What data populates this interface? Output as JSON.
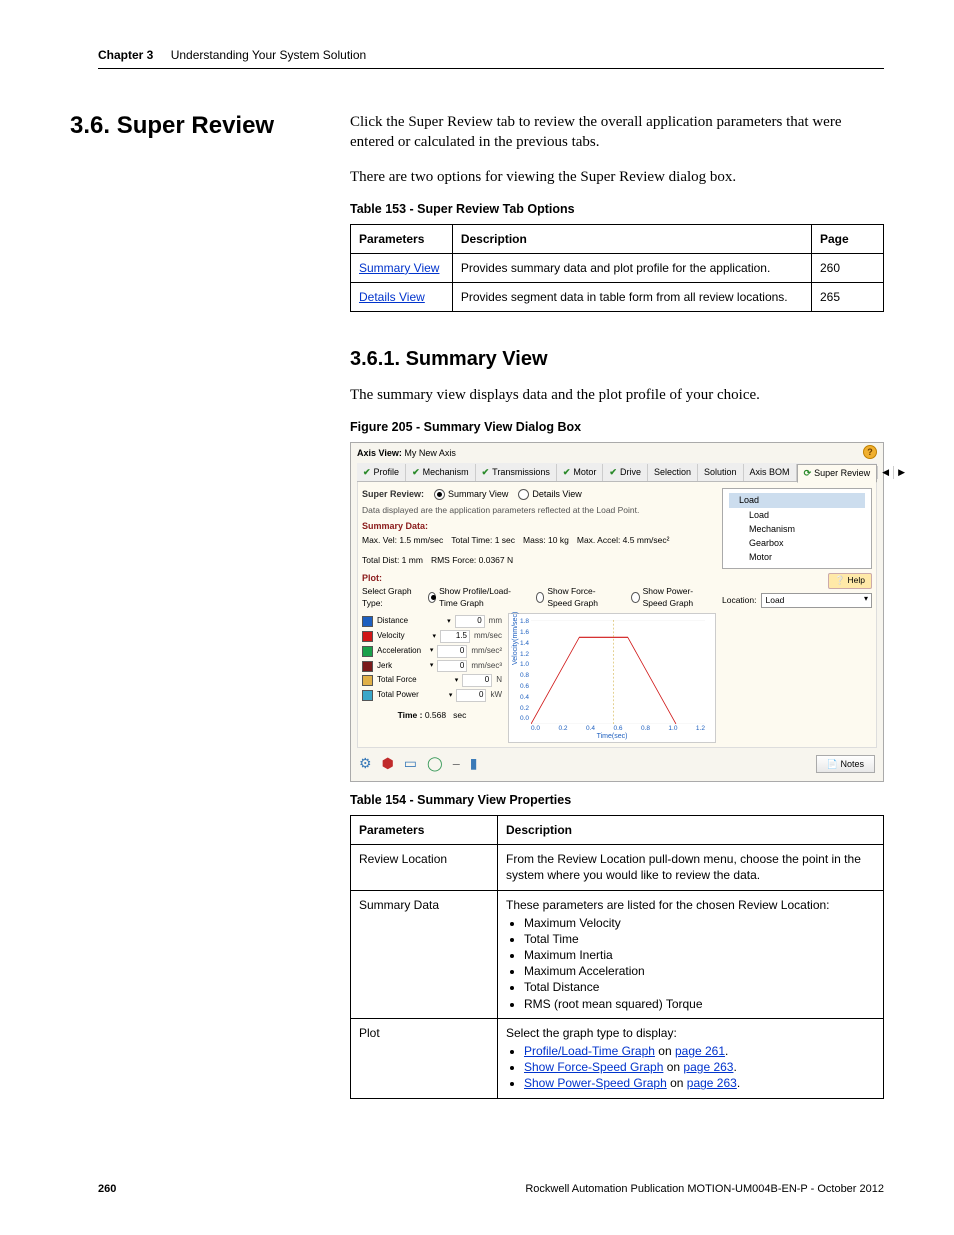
{
  "header": {
    "chapter": "Chapter 3",
    "title": "Understanding Your System Solution"
  },
  "section": {
    "number_title": "3.6.  Super Review",
    "intro1": "Click the Super Review tab to review the overall application parameters that were entered or calculated in the previous tabs.",
    "intro2": "There are two options for viewing the Super Review dialog box."
  },
  "table153": {
    "caption": "Table 153 - Super Review Tab Options",
    "headers": [
      "Parameters",
      "Description",
      "Page"
    ],
    "rows": [
      {
        "param": "Summary View",
        "desc": "Provides summary data and plot profile for the application.",
        "page": "260"
      },
      {
        "param": "Details View",
        "desc": "Provides segment data in table form from all review locations.",
        "page": "265"
      }
    ]
  },
  "subsection": {
    "title": "3.6.1.   Summary View",
    "intro": "The summary view displays data and the plot profile of your choice."
  },
  "figure": {
    "caption": "Figure 205 - Summary View Dialog Box"
  },
  "screenshot": {
    "axis_view_label": "Axis View:",
    "axis_view_value": "My New Axis",
    "tabs": [
      "Profile",
      "Mechanism",
      "Transmissions",
      "Motor",
      "Drive",
      "Selection",
      "Solution",
      "Axis BOM",
      "Super Review"
    ],
    "checked_tabs": [
      0,
      1,
      2,
      3,
      4
    ],
    "reload_tab_index": 8,
    "sr_label": "Super Review:",
    "sr_radio_summary": "Summary View",
    "sr_radio_details": "Details View",
    "hint": "Data displayed are the application parameters reflected at the Load Point.",
    "summary_data_label": "Summary Data:",
    "summary_values": [
      [
        "Max. Vel:",
        "1.5",
        "mm/sec"
      ],
      [
        "Total Time:",
        "1",
        "sec"
      ],
      [
        "Mass:",
        "10",
        "kg"
      ],
      [
        "Max. Accel:",
        "4.5",
        "mm/sec²"
      ],
      [
        "Total Dist:",
        "1",
        "mm"
      ],
      [
        "RMS Force:",
        "0.0367",
        "N"
      ]
    ],
    "plot_label": "Plot:",
    "graph_type_label": "Select Graph Type:",
    "graph_options": [
      "Show Profile/Load-Time Graph",
      "Show Force-Speed Graph",
      "Show Power-Speed Graph"
    ],
    "legend": [
      {
        "name": "Distance",
        "color": "#1d5fbf",
        "val": "0",
        "unit": "mm"
      },
      {
        "name": "Velocity",
        "color": "#d01616",
        "val": "1.5",
        "unit": "mm/sec"
      },
      {
        "name": "Acceleration",
        "color": "#1aa04a",
        "val": "0",
        "unit": "mm/sec²"
      },
      {
        "name": "Jerk",
        "color": "#7a1a1a",
        "val": "0",
        "unit": "mm/sec³"
      },
      {
        "name": "Total Force",
        "color": "#e0b048",
        "val": "0",
        "unit": "N"
      },
      {
        "name": "Total Power",
        "color": "#3aa7c9",
        "val": "0",
        "unit": "kW"
      }
    ],
    "time_label": "Time :",
    "time_value": "0.568",
    "time_unit": "sec",
    "tree": {
      "root": "Load",
      "items": [
        "Load",
        "Mechanism",
        "Gearbox",
        "Motor"
      ]
    },
    "help": "Help",
    "location_label": "Location:",
    "location_value": "Load",
    "notes": "Notes",
    "chart_xlabel": "Time(sec)",
    "chart_ylabel": "Velocity(mm/sec)"
  },
  "chart_data": {
    "type": "line",
    "title": "",
    "xlabel": "Time(sec)",
    "ylabel": "Velocity(mm/sec)",
    "xlim": [
      0.0,
      1.2
    ],
    "ylim": [
      0.0,
      1.8
    ],
    "xticks": [
      0.0,
      0.2,
      0.4,
      0.6,
      0.8,
      1.0,
      1.2
    ],
    "yticks": [
      0.0,
      0.2,
      0.4,
      0.6,
      0.8,
      1.0,
      1.2,
      1.4,
      1.6,
      1.8
    ],
    "series": [
      {
        "name": "Velocity",
        "color": "#d01616",
        "x": [
          0.0,
          0.333,
          0.667,
          1.0
        ],
        "y": [
          0.0,
          1.5,
          1.5,
          0.0
        ]
      }
    ]
  },
  "table154": {
    "caption": "Table 154 - Summary View Properties",
    "headers": [
      "Parameters",
      "Description"
    ],
    "rows": [
      {
        "param": "Review Location",
        "desc": "From the Review Location pull-down menu, choose the point in the system where you would like to review the data."
      },
      {
        "param": "Summary Data",
        "desc_intro": "These parameters are listed for the chosen Review Location:",
        "bullets": [
          "Maximum Velocity",
          "Total Time",
          "Maximum Inertia",
          "Maximum Acceleration",
          "Total Distance",
          "RMS (root mean squared) Torque"
        ]
      },
      {
        "param": "Plot",
        "desc_intro": "Select the graph type to display:",
        "link_bullets": [
          {
            "text": "Profile/Load-Time Graph",
            "suffix": " on ",
            "page": "page 261"
          },
          {
            "text": "Show Force-Speed Graph",
            "suffix": " on ",
            "page": "page 263"
          },
          {
            "text": "Show Power-Speed Graph",
            "suffix": " on ",
            "page": "page 263"
          }
        ]
      }
    ]
  },
  "footer": {
    "page": "260",
    "pub": "Rockwell Automation Publication MOTION-UM004B-EN-P - October 2012"
  }
}
